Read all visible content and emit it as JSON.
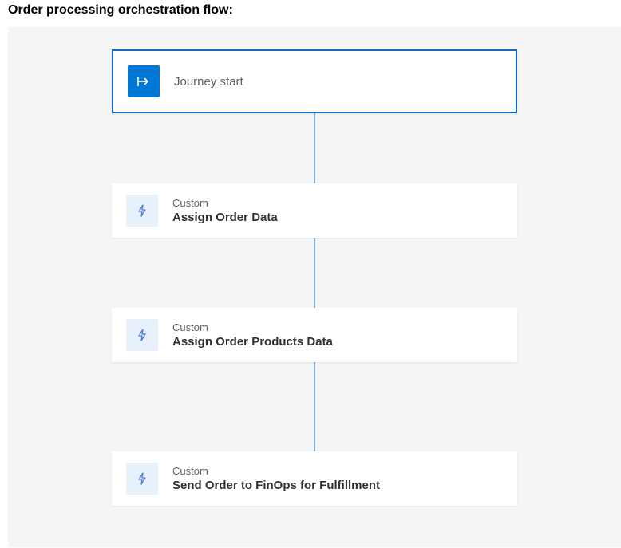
{
  "page": {
    "title": "Order processing orchestration flow:"
  },
  "flow": {
    "start": {
      "label": "Journey start"
    },
    "nodes": [
      {
        "category": "Custom",
        "title": "Assign Order Data"
      },
      {
        "category": "Custom",
        "title": "Assign Order Products Data"
      },
      {
        "category": "Custom",
        "title": "Send Order to FinOps for Fulfillment"
      }
    ]
  },
  "colors": {
    "primary": "#0078d4",
    "light_icon_bg": "#e8f1fb",
    "connector": "#7eb0e0",
    "canvas_bg": "#f5f5f5"
  }
}
